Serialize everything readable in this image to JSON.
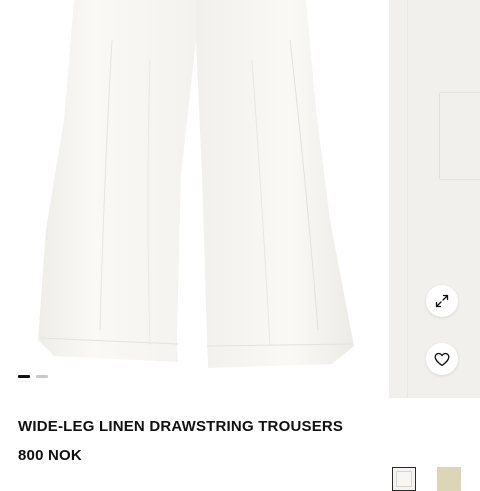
{
  "product": {
    "title": "WIDE-LEG LINEN DRAWSTRING TROUSERS",
    "price": "800 NOK"
  },
  "gallery": {
    "slides": [
      {
        "name": "main-product-image",
        "description": "white wide-leg linen trousers, lower legs"
      },
      {
        "name": "detail-image",
        "description": "close-up of side pocket"
      }
    ],
    "active_slide": 1,
    "slide_count": 2
  },
  "actions": {
    "expand_icon": "expand-arrows-icon",
    "wishlist_icon": "heart-outline-icon"
  },
  "colors": {
    "swatches": [
      {
        "name": "white",
        "hex": "#f5f4f0",
        "selected": true
      },
      {
        "name": "beige",
        "hex": "#ddd5b8",
        "selected": false
      }
    ],
    "text": "#111111",
    "background": "#ffffff",
    "fabric": "#f7f6f2"
  }
}
